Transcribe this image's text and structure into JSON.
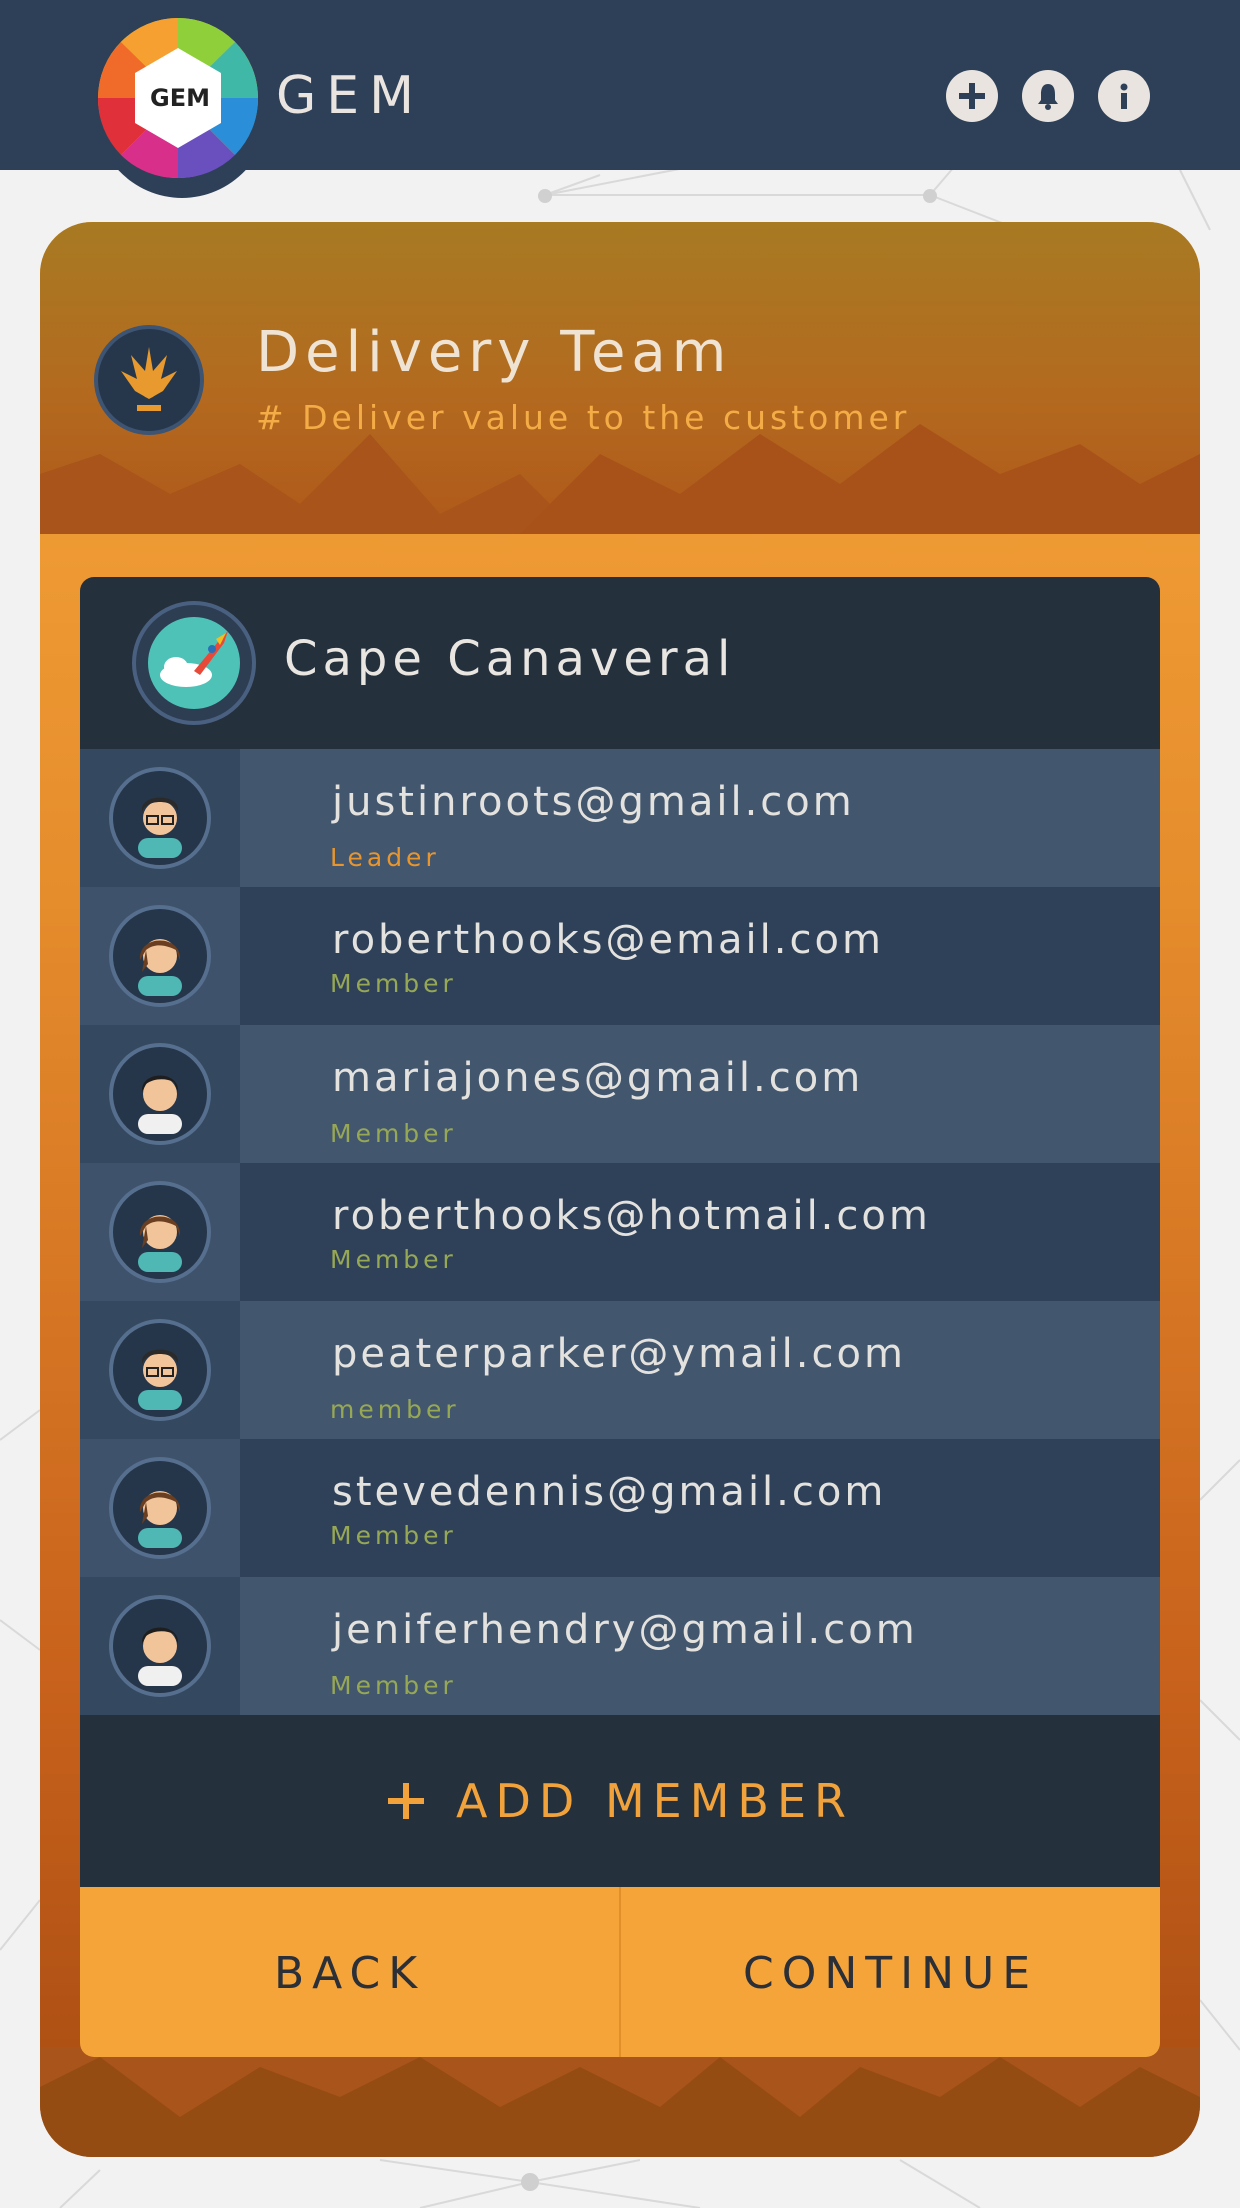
{
  "app": {
    "logo_text": "GEM",
    "brand": "GEM"
  },
  "topbar": {
    "icons": [
      "plus-icon",
      "bell-icon",
      "info-icon"
    ]
  },
  "team": {
    "title": "Delivery Team",
    "subtitle": "# Deliver value to the customer",
    "badge_icon": "jedi-emblem-icon"
  },
  "group": {
    "name": "Cape Canaveral",
    "badge_icon": "rocket-icon"
  },
  "members": [
    {
      "email": "justinroots@gmail.com",
      "role": "Leader",
      "avatar": "man-glasses"
    },
    {
      "email": "roberthooks@email.com",
      "role": "Member",
      "avatar": "woman-brown-hair"
    },
    {
      "email": "mariajones@gmail.com",
      "role": "Member",
      "avatar": "man-dark-hair"
    },
    {
      "email": "roberthooks@hotmail.com",
      "role": "Member",
      "avatar": "woman-brown-hair"
    },
    {
      "email": "peaterparker@ymail.com",
      "role": "member",
      "avatar": "man-glasses"
    },
    {
      "email": "stevedennis@gmail.com",
      "role": "Member",
      "avatar": "woman-brown-hair"
    },
    {
      "email": "jeniferhendry@gmail.com",
      "role": "Member",
      "avatar": "man-dark-hair"
    }
  ],
  "actions": {
    "add_member": "ADD MEMBER",
    "back": "BACK",
    "continue": "CONTINUE"
  },
  "colors": {
    "topbar": "#2e4058",
    "accent": "#f5a43a",
    "panel_dark": "#25303d",
    "leader_role": "#e7962f",
    "member_role": "#97a855"
  }
}
